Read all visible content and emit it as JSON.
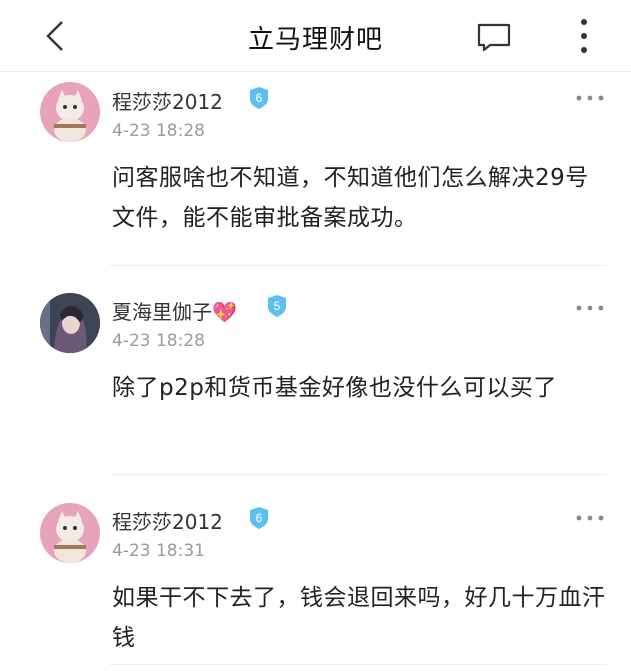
{
  "header": {
    "title": "立马理财吧"
  },
  "posts": [
    {
      "username": "程莎莎2012",
      "level": "6",
      "time": "4-23 18:28",
      "text": "问客服啥也不知道，不知道他们怎么解决29号文件，能不能审批备案成功。"
    },
    {
      "username": "夏海里伽子💖",
      "level": "5",
      "time": "4-23 18:28",
      "text": "除了p2p和货币基金好像也没什么可以买了"
    },
    {
      "username": "程莎莎2012",
      "level": "6",
      "time": "4-23 18:31",
      "text": "如果干不下去了，钱会退回来吗，好几十万血汗钱"
    }
  ],
  "colors": {
    "badge": "#5bc0f0",
    "avatar_pink": "#e7a3b9",
    "avatar_dark": "#5b6170"
  }
}
